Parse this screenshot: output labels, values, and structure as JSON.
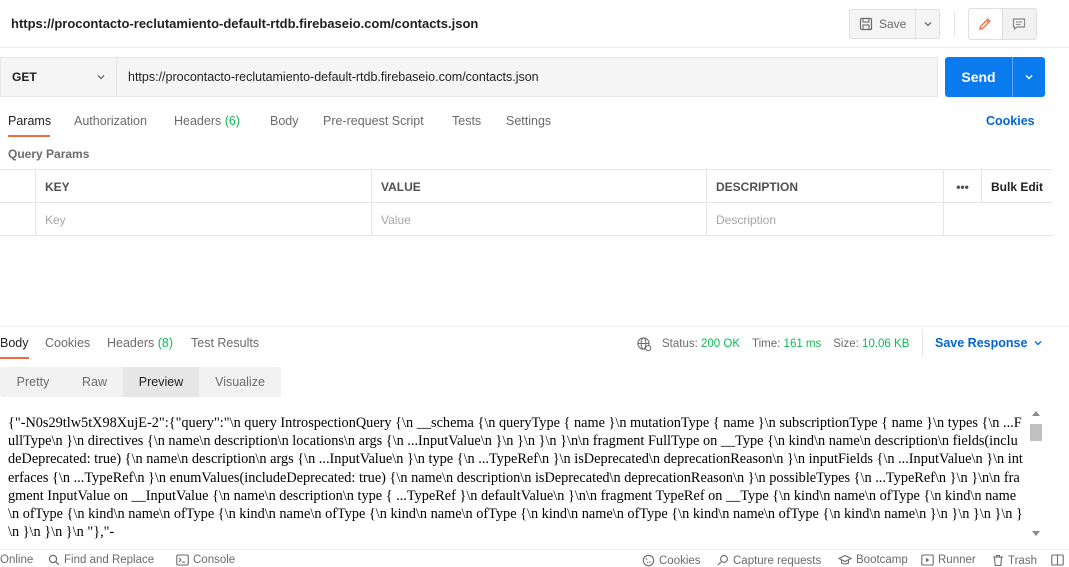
{
  "header": {
    "title": "https://procontacto-reclutamiento-default-rtdb.firebaseio.com/contacts.json",
    "save_label": "Save"
  },
  "request": {
    "method": "GET",
    "url": "https://procontacto-reclutamiento-default-rtdb.firebaseio.com/contacts.json",
    "send_label": "Send"
  },
  "request_tabs": {
    "params": "Params",
    "authorization": "Authorization",
    "headers": "Headers",
    "headers_count": "(6)",
    "body": "Body",
    "prerequest": "Pre-request Script",
    "tests": "Tests",
    "settings": "Settings",
    "cookies": "Cookies"
  },
  "query_params": {
    "title": "Query Params",
    "columns": {
      "key": "KEY",
      "value": "VALUE",
      "description": "DESCRIPTION",
      "more": "•••",
      "bulk_edit": "Bulk Edit"
    },
    "placeholders": {
      "key": "Key",
      "value": "Value",
      "description": "Description"
    }
  },
  "response_tabs": {
    "body": "Body",
    "cookies": "Cookies",
    "headers": "Headers",
    "headers_count": "(8)",
    "test_results": "Test Results"
  },
  "response_status": {
    "status_label": "Status:",
    "status_value": "200 OK",
    "time_label": "Time:",
    "time_value": "161 ms",
    "size_label": "Size:",
    "size_value": "10.06 KB",
    "save_response": "Save Response"
  },
  "format_tabs": {
    "pretty": "Pretty",
    "raw": "Raw",
    "preview": "Preview",
    "visualize": "Visualize",
    "active": "preview"
  },
  "preview_text": "{\"-N0s29tlw5tX98XujE-2\":{\"query\":\"\\n query IntrospectionQuery {\\n __schema {\\n queryType { name }\\n mutationType { name }\\n subscriptionType { name }\\n types {\\n ...FullType\\n }\\n directives {\\n name\\n description\\n locations\\n args {\\n ...InputValue\\n }\\n }\\n }\\n }\\n\\n fragment FullType on __Type {\\n kind\\n name\\n description\\n fields(includeDeprecated: true) {\\n name\\n description\\n args {\\n ...InputValue\\n }\\n type {\\n ...TypeRef\\n }\\n isDeprecated\\n deprecationReason\\n }\\n inputFields {\\n ...InputValue\\n }\\n interfaces {\\n ...TypeRef\\n }\\n enumValues(includeDeprecated: true) {\\n name\\n description\\n isDeprecated\\n deprecationReason\\n }\\n possibleTypes {\\n ...TypeRef\\n }\\n }\\n\\n fragment InputValue on __InputValue {\\n name\\n description\\n type { ...TypeRef }\\n defaultValue\\n }\\n\\n fragment TypeRef on __Type {\\n kind\\n name\\n ofType {\\n kind\\n name\\n ofType {\\n kind\\n name\\n ofType {\\n kind\\n name\\n ofType {\\n kind\\n name\\n ofType {\\n kind\\n name\\n ofType {\\n kind\\n name\\n ofType {\\n kind\\n name\\n }\\n }\\n }\\n }\\n }\\n }\\n }\\n }\\n \"},\"-",
  "footer": {
    "online": "Online",
    "find_replace": "Find and Replace",
    "console": "Console",
    "cookies": "Cookies",
    "capture": "Capture requests",
    "bootcamp": "Bootcamp",
    "runner": "Runner",
    "trash": "Trash"
  },
  "colors": {
    "send": "#097bed",
    "active_tab_underline": "#f26b3a",
    "count_green": "#0cbb52",
    "link_blue": "#0265d2"
  }
}
